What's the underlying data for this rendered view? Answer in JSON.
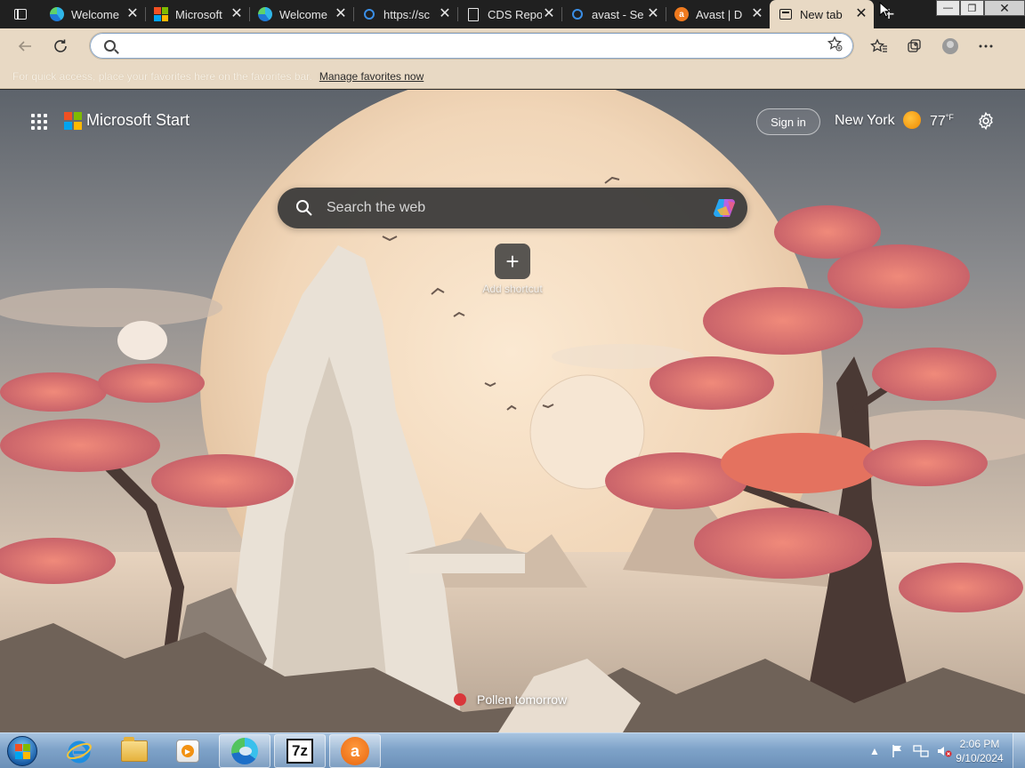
{
  "tabs": [
    {
      "title": "Welcome",
      "icon": "edge-icon",
      "active": false
    },
    {
      "title": "Microsoft",
      "icon": "microsoft-logo-icon",
      "active": false
    },
    {
      "title": "Welcome",
      "icon": "edge-icon",
      "active": false
    },
    {
      "title": "https://sc",
      "icon": "search-icon",
      "active": false
    },
    {
      "title": "CDS Repo",
      "icon": "document-icon",
      "active": false
    },
    {
      "title": "avast - Se",
      "icon": "search-icon",
      "active": false
    },
    {
      "title": "Avast | D",
      "icon": "avast-icon",
      "active": false
    },
    {
      "title": "New tab",
      "icon": "new-tab-icon",
      "active": true
    }
  ],
  "tab_close_glyph": "✕",
  "new_tab_glyph": "+",
  "address_bar": {
    "value": "",
    "placeholder": ""
  },
  "favorites_bar": {
    "message": "For quick access, place your favorites here on the favorites bar.",
    "link": "Manage favorites now"
  },
  "start_page": {
    "brand": "Microsoft Start",
    "sign_in": "Sign in",
    "city": "New York",
    "temperature": "77",
    "temperature_unit": "°F",
    "search_placeholder": "Search the web",
    "add_shortcut_glyph": "+",
    "add_shortcut_label": "Add shortcut",
    "pollen": "Pollen tomorrow"
  },
  "taskbar": {
    "clock_time": "2:06 PM",
    "clock_date": "9/10/2024",
    "apps": [
      "internet-explorer",
      "file-explorer",
      "media-player",
      "edge",
      "7-zip",
      "avast"
    ],
    "sevenzip_label": "7z",
    "avast_label": "a"
  },
  "colors": {
    "tab_bar": "#202020",
    "toolbar": "#e8d9c4",
    "microsoft_red": "#f25022",
    "microsoft_green": "#7fba00",
    "microsoft_blue": "#00a4ef",
    "microsoft_yellow": "#ffb900",
    "pollen_indicator": "#d9373b"
  }
}
